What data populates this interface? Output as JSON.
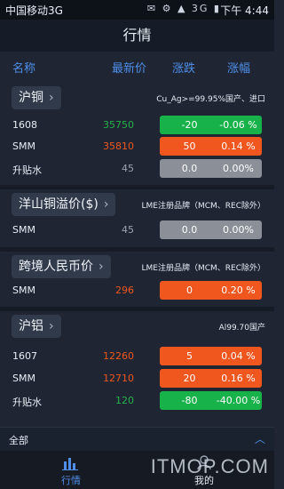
{
  "status": {
    "carrier": "中国移动3G",
    "time": "下午 4:44",
    "icons": "✉ ⚙ ▲ 3G ▮"
  },
  "title": "行情",
  "columns": {
    "name": "名称",
    "price": "最新价",
    "change": "涨跌",
    "pct": "涨幅"
  },
  "sections": [
    {
      "label": "沪铜",
      "note": "Cu_Ag>=99.95%国产、进口",
      "rows": [
        {
          "name": "1608",
          "price": "35750",
          "change": "-20",
          "pct": "-0.06 %"
        },
        {
          "name": "SMM",
          "price": "35810",
          "change": "50",
          "pct": "0.14 %"
        },
        {
          "name": "升贴水",
          "price": "45",
          "change": "0.0",
          "pct": "0.00%"
        }
      ]
    },
    {
      "label": "洋山铜溢价($)",
      "note": "LME注册品牌（MCM、REC除外）",
      "rows": [
        {
          "name": "SMM",
          "price": "45",
          "change": "0.0",
          "pct": "0.00%"
        }
      ]
    },
    {
      "label": "跨境人民币价",
      "note": "LME注册品牌（MCM、REC除外）",
      "rows": [
        {
          "name": "SMM",
          "price": "296",
          "change": "0",
          "pct": "0.20 %"
        }
      ]
    },
    {
      "label": "沪铝",
      "note": "Al99.70国产",
      "rows": [
        {
          "name": "1607",
          "price": "12260",
          "change": "5",
          "pct": "0.04 %"
        },
        {
          "name": "SMM",
          "price": "12710",
          "change": "20",
          "pct": "0.16 %"
        },
        {
          "name": "升贴水",
          "price": "120",
          "change": "-80",
          "pct": "-40.00 %"
        }
      ]
    }
  ],
  "bottom": {
    "all_label": "全部",
    "caret": "︿"
  },
  "tabs": [
    {
      "label": "行情"
    },
    {
      "label": "我的"
    }
  ],
  "watermark": "ITMOP.COM",
  "colors": {
    "up": "#f0571e",
    "down": "#18b24a",
    "flat": "#8a8f98",
    "accent": "#4f8fe8"
  }
}
